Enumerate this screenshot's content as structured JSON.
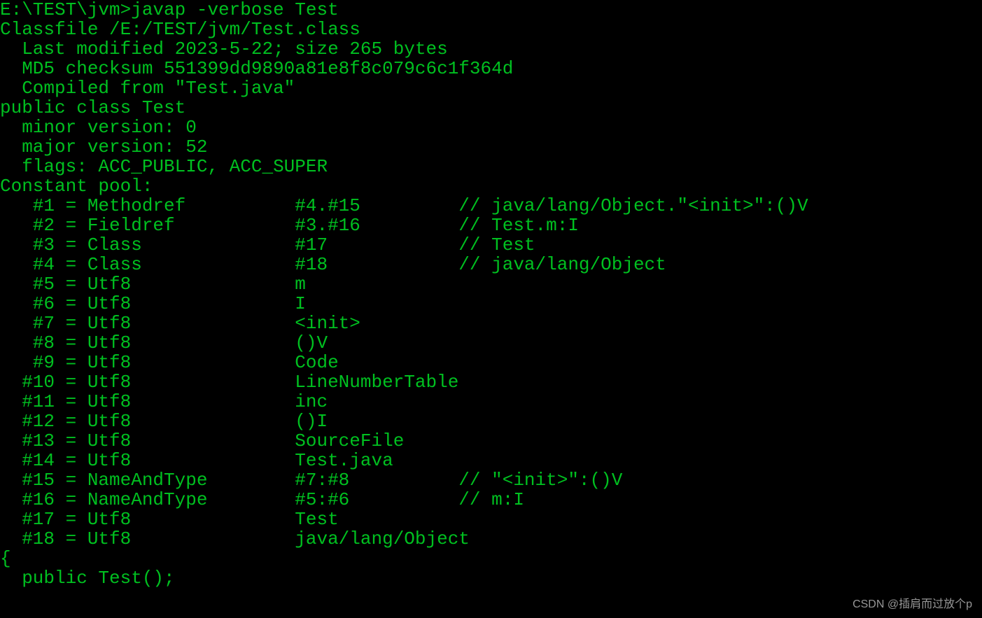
{
  "terminal": {
    "prompt_line": "E:\\TEST\\jvm>javap -verbose Test",
    "header": [
      "Classfile /E:/TEST/jvm/Test.class",
      "  Last modified 2023-5-22; size 265 bytes",
      "  MD5 checksum 551399dd9890a81e8f8c079c6c1f364d",
      "  Compiled from \"Test.java\"",
      "public class Test",
      "  minor version: 0",
      "  major version: 52",
      "  flags: ACC_PUBLIC, ACC_SUPER",
      "Constant pool:"
    ],
    "constant_pool": [
      "   #1 = Methodref          #4.#15         // java/lang/Object.\"<init>\":()V",
      "   #2 = Fieldref           #3.#16         // Test.m:I",
      "   #3 = Class              #17            // Test",
      "   #4 = Class              #18            // java/lang/Object",
      "   #5 = Utf8               m",
      "   #6 = Utf8               I",
      "   #7 = Utf8               <init>",
      "   #8 = Utf8               ()V",
      "   #9 = Utf8               Code",
      "  #10 = Utf8               LineNumberTable",
      "  #11 = Utf8               inc",
      "  #12 = Utf8               ()I",
      "  #13 = Utf8               SourceFile",
      "  #14 = Utf8               Test.java",
      "  #15 = NameAndType        #7:#8          // \"<init>\":()V",
      "  #16 = NameAndType        #5:#6          // m:I",
      "  #17 = Utf8               Test",
      "  #18 = Utf8               java/lang/Object"
    ],
    "tail": [
      "{",
      "  public Test();"
    ]
  },
  "watermark": "CSDN @插肩而过放个p"
}
